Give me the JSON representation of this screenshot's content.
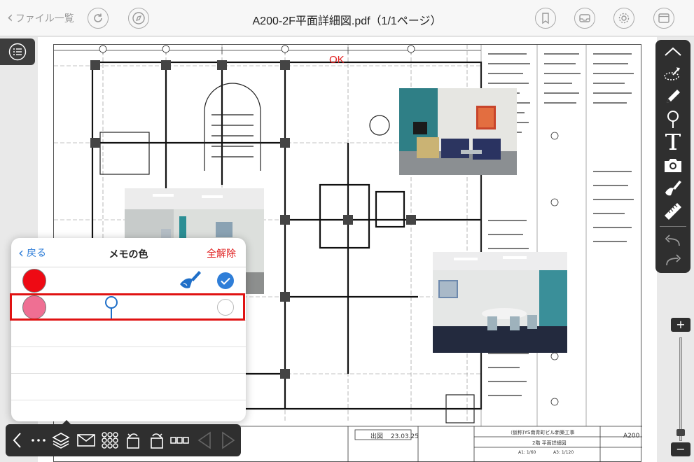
{
  "header": {
    "back_label": "ファイル一覧",
    "title": "A200-2F平面詳細図.pdf（1/1ページ）"
  },
  "drawing": {
    "ok_label": "OK",
    "stamp_label": "出図",
    "stamp_date": "23.03.25",
    "sheet_number": "A200",
    "project_name": "（仮称)YS南青町ビル新築工事",
    "drawing_title": "2階 平面詳細図",
    "scale_a1": "A1: 1/60",
    "scale_a3": "A3: 1/120"
  },
  "memo_popover": {
    "back_label": "戻る",
    "title": "メモの色",
    "clear_label": "全解除",
    "rows": [
      {
        "color": "#ee0a14",
        "icon": "brush-icon",
        "checked": true
      },
      {
        "color": "#ef6f93",
        "icon": "map-pin-icon",
        "checked": false
      }
    ]
  },
  "colors": {
    "accent": "#2f7ed8",
    "danger": "#e02020",
    "toolbar": "#2f2f2f"
  },
  "right_toolbar": [
    "chevron-up-icon",
    "lasso-icon",
    "pencil-icon",
    "map-pin-icon",
    "text-icon",
    "camera-icon",
    "brush-icon",
    "ruler-icon",
    "undo-icon",
    "redo-icon"
  ],
  "bottom_toolbar": [
    "chevron-left-icon",
    "more-icon",
    "layers-icon",
    "mail-icon",
    "grid-icon",
    "rotate-left-icon",
    "rotate-right-icon",
    "thumbnails-icon",
    "prev-page-icon",
    "next-page-icon"
  ],
  "zoom": {
    "plus": "+",
    "minus": "−",
    "level": 0.05
  }
}
